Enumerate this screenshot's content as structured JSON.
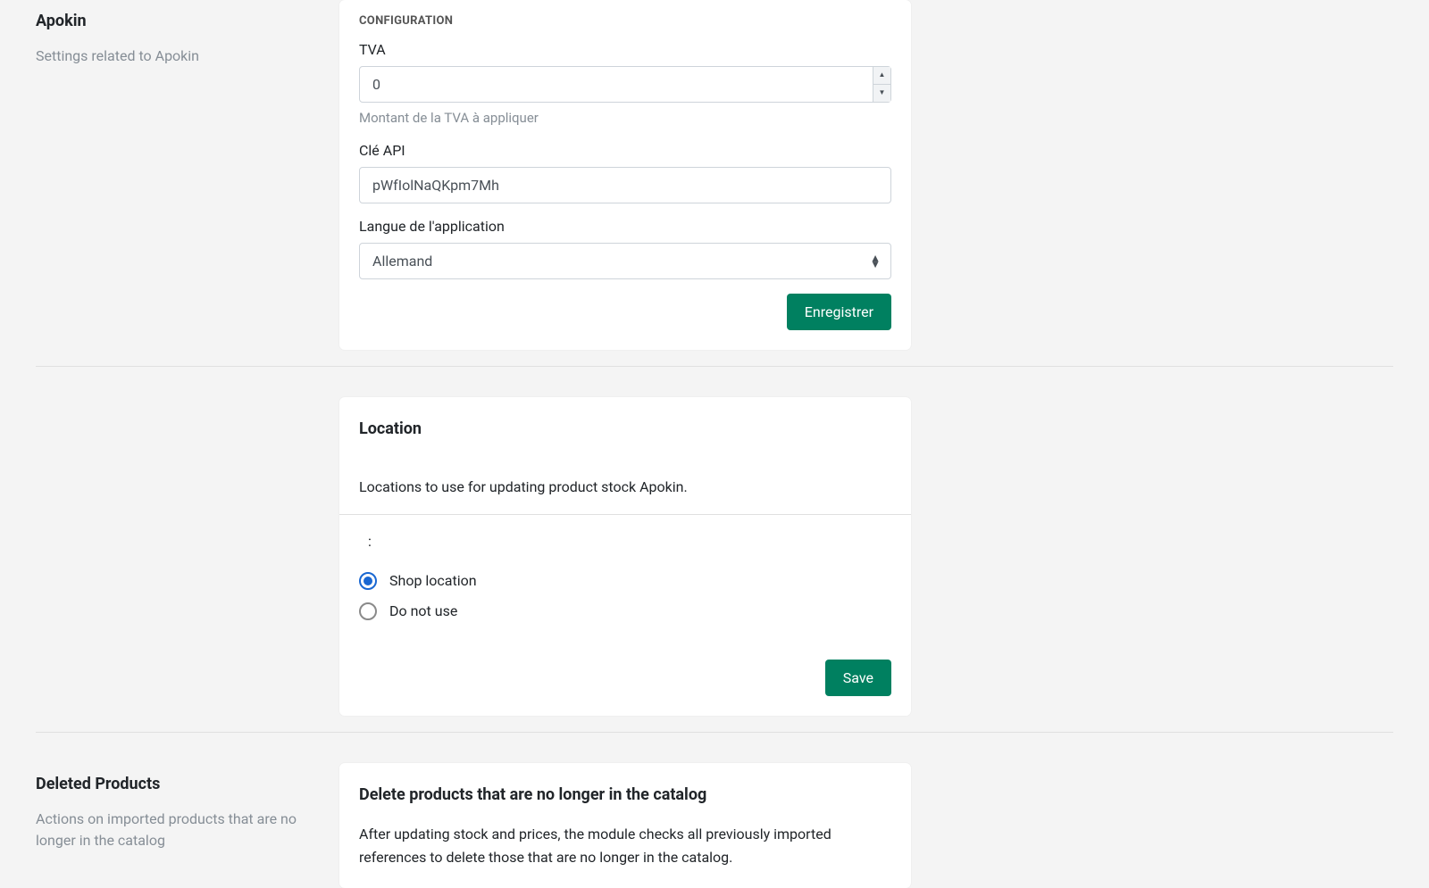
{
  "apokin": {
    "title": "Apokin",
    "description": "Settings related to Apokin",
    "config_section_label": "CONFIGURATION",
    "tva_label": "TVA",
    "tva_value": "0",
    "tva_help": "Montant de la TVA à appliquer",
    "api_label": "Clé API",
    "api_value": "pWfIolNaQKpm7Mh",
    "lang_label": "Langue de l'application",
    "lang_selected": "Allemand",
    "save_label": "Enregistrer"
  },
  "location": {
    "card_title": "Location",
    "intro": "Locations to use for updating product stock Apokin.",
    "colon": ":",
    "options": [
      {
        "label": "Shop location",
        "selected": true
      },
      {
        "label": "Do not use",
        "selected": false
      }
    ],
    "save_label": "Save"
  },
  "deleted": {
    "title": "Deleted Products",
    "description": "Actions on imported products that are no longer in the catalog",
    "card_title": "Delete products that are no longer in the catalog",
    "body": "After updating stock and prices, the module checks all previously imported references to delete those that are no longer in the catalog."
  }
}
